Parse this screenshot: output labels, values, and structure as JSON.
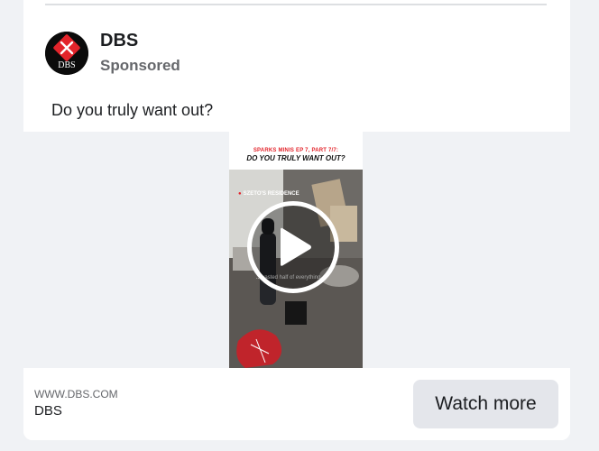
{
  "post": {
    "advertiser": "DBS",
    "sponsored_label": "Sponsored",
    "logo_text": "DBS",
    "text": "Do you truly want out?"
  },
  "video": {
    "kicker": "SPARKS MINIS EP 7, PART 7/7:",
    "title": "DO YOU TRULY WANT OUT?",
    "location": "SZETO'S RESIDENCE",
    "subtitle": "...wasted half of everything..."
  },
  "link": {
    "domain": "WWW.DBS.COM",
    "title": "DBS",
    "cta_label": "Watch more"
  },
  "colors": {
    "brand_red": "#e3242b",
    "card_bg": "#ffffff",
    "feed_bg": "#f0f2f5",
    "button_bg": "#e4e6eb",
    "muted_text": "#65676b"
  },
  "icons": {
    "logo": "dbs-logo-icon",
    "play": "play-icon",
    "location": "location-pin-icon"
  }
}
